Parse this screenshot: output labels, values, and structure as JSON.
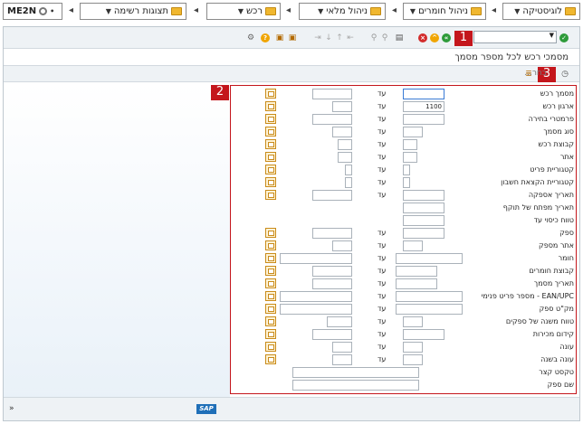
{
  "breadcrumbs": [
    "לוגיסטיקה",
    "ניהול חומרים",
    "ניהול מלאי",
    "רכש",
    "תצוגות רשימה"
  ],
  "transaction": "ME2N",
  "markers": [
    "1",
    "2",
    "3"
  ],
  "title": "מסמכי רכש לכל מספר מסמך",
  "choose_label": "בחר...",
  "to_label": "עד",
  "sap_logo": "SAP",
  "expand_glyph": "»",
  "fields": [
    {
      "label": "מסמך רכש",
      "value": ""
    },
    {
      "label": "ארגון רכש",
      "value": "1100"
    },
    {
      "label": "פרמטרי בחירה",
      "value": ""
    },
    {
      "label": "סוג מסמך",
      "value": ""
    },
    {
      "label": "קבוצת רכש",
      "value": ""
    },
    {
      "label": "אתר",
      "value": ""
    },
    {
      "label": "קטגוריית פריט",
      "value": ""
    },
    {
      "label": "קטגוריית הקצאת חשבון",
      "value": ""
    },
    {
      "label": "תאריך אספקה",
      "value": ""
    },
    {
      "label": "תאריך מפתח של תוקף",
      "value": ""
    },
    {
      "label": "טווח כיסוי עד",
      "value": ""
    },
    {
      "label": "ספק",
      "value": ""
    },
    {
      "label": "אתר מספק",
      "value": ""
    },
    {
      "label": "חומר",
      "value": ""
    },
    {
      "label": "קבוצת חומרים",
      "value": ""
    },
    {
      "label": "תאריך מסמך",
      "value": ""
    },
    {
      "label": "EAN/UPC - מספר פריט פנימי",
      "value": ""
    },
    {
      "label": "מק\"ט ספק",
      "value": ""
    },
    {
      "label": "טווח משנה של ספקים",
      "value": ""
    },
    {
      "label": "קידום מכירות",
      "value": ""
    },
    {
      "label": "עונה",
      "value": ""
    },
    {
      "label": "עונה בשנה",
      "value": ""
    },
    {
      "label": "טקסט קצר",
      "value": ""
    },
    {
      "label": "שם ספק",
      "value": ""
    }
  ]
}
